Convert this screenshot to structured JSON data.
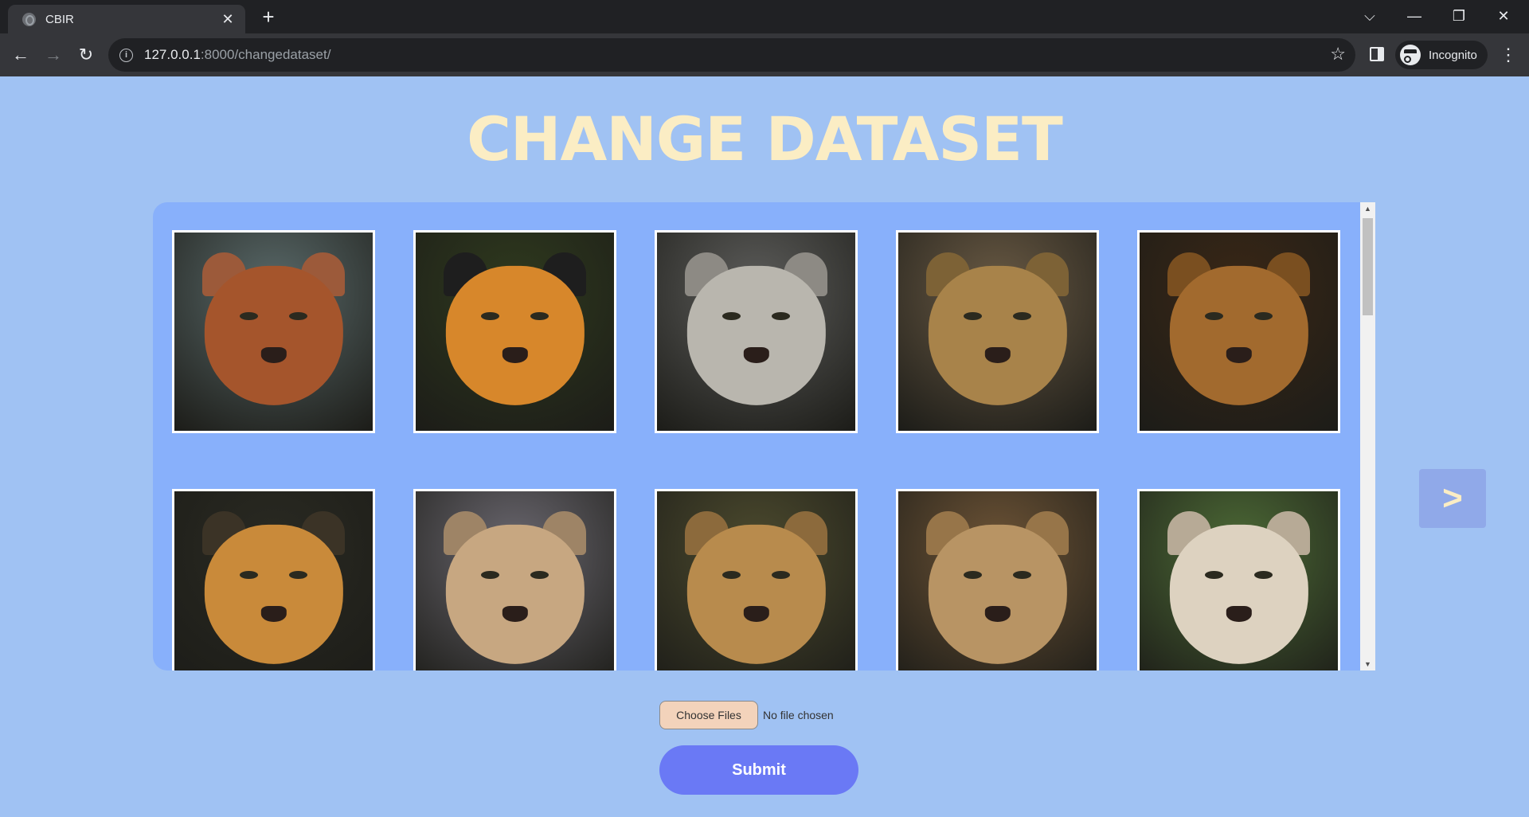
{
  "browser": {
    "tab_title": "CBIR",
    "tab_close": "✕",
    "new_tab": "+",
    "url_host": "127.0.0.1",
    "url_path": ":8000/changedataset/",
    "profile_label": "Incognito",
    "window_controls": [
      "⌵",
      "—",
      "❐",
      "✕"
    ],
    "nav": {
      "back": "←",
      "forward": "→",
      "reload": "↻"
    },
    "menu": "⋮",
    "star": "☆"
  },
  "page": {
    "title": "CHANGE DATASET",
    "next_label": ">",
    "file_button_label": "Choose Files",
    "file_status": "No file chosen",
    "submit_label": "Submit"
  },
  "gallery": {
    "images": [
      {
        "name": "maned-wolf-image",
        "bg": "#5a6a6a",
        "fur": "#a5552c",
        "ear": "#9c5a3a"
      },
      {
        "name": "tiger-image",
        "bg": "#2f3a1e",
        "fur": "#d7872b",
        "ear": "#1e1e1e"
      },
      {
        "name": "snow-leopard-image",
        "bg": "#5d5d5b",
        "fur": "#b9b6ae",
        "ear": "#8d8a84"
      },
      {
        "name": "jaguar-image",
        "bg": "#6a5a44",
        "fur": "#a8834a",
        "ear": "#7d6236"
      },
      {
        "name": "lion-image",
        "bg": "#3a2716",
        "fur": "#a26a2e",
        "ear": "#7a4f20"
      },
      {
        "name": "siberian-tiger-image",
        "bg": "#2a2a22",
        "fur": "#c98a3a",
        "ear": "#3b3326"
      },
      {
        "name": "cheetah-image",
        "bg": "#6b6870",
        "fur": "#c7a781",
        "ear": "#9e8466"
      },
      {
        "name": "cheetah-cub-image",
        "bg": "#4d4b2e",
        "fur": "#b88b4d",
        "ear": "#8c6a3c"
      },
      {
        "name": "lioness-image",
        "bg": "#6e5436",
        "fur": "#b89464",
        "ear": "#977549"
      },
      {
        "name": "white-tiger-image",
        "bg": "#4d6b36",
        "fur": "#ddd2c0",
        "ear": "#b7aa96"
      }
    ]
  }
}
